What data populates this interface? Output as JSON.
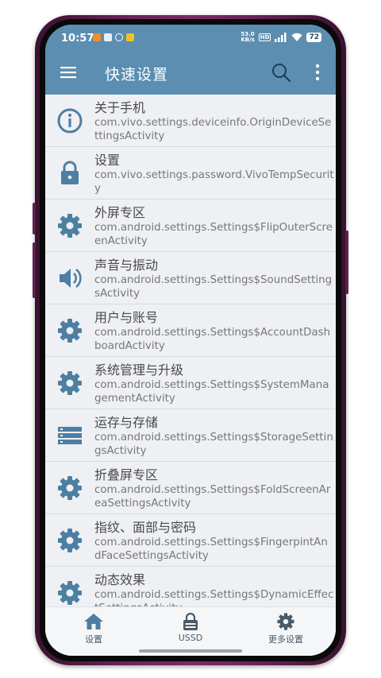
{
  "status_bar": {
    "time": "10:57",
    "net_speed_value": "53.0",
    "net_speed_unit": "KB/s",
    "hd_label": "HD",
    "battery": "72"
  },
  "toolbar": {
    "title": "快速设置",
    "menu_icon": "hamburger-menu-icon",
    "search_icon": "search-icon",
    "more_icon": "more-vert-icon"
  },
  "colors": {
    "appbar": "#5b8eb0",
    "icon": "#4d7fa2",
    "frame": "#6b2358"
  },
  "items": [
    {
      "icon": "info-icon",
      "title": "关于手机",
      "subtitle": "com.vivo.settings.deviceinfo.OriginDeviceSettingsActivity"
    },
    {
      "icon": "lock-icon",
      "title": "设置",
      "subtitle": "com.vivo.settings.password.VivoTempSecurity"
    },
    {
      "icon": "gear-icon",
      "title": "外屏专区",
      "subtitle": "com.android.settings.Settings$FlipOuterScreenActivity"
    },
    {
      "icon": "volume-icon",
      "title": "声音与振动",
      "subtitle": "com.android.settings.Settings$SoundSettingsActivity"
    },
    {
      "icon": "gear-icon",
      "title": "用户与账号",
      "subtitle": "com.android.settings.Settings$AccountDashboardActivity"
    },
    {
      "icon": "gear-icon",
      "title": "系统管理与升级",
      "subtitle": "com.android.settings.Settings$SystemManagementActivity"
    },
    {
      "icon": "storage-icon",
      "title": "运存与存储",
      "subtitle": "com.android.settings.Settings$StorageSettingsActivity"
    },
    {
      "icon": "gear-icon",
      "title": "折叠屏专区",
      "subtitle": "com.android.settings.Settings$FoldScreenAreaSettingsActivity"
    },
    {
      "icon": "gear-icon",
      "title": "指纹、面部与密码",
      "subtitle": "com.android.settings.Settings$FingerpintAndFaceSettingsActivity"
    },
    {
      "icon": "gear-icon",
      "title": "动态效果",
      "subtitle": "com.android.settings.Settings$DynamicEffectSettingsActivity"
    }
  ],
  "bottom_nav": [
    {
      "icon": "home-icon",
      "label": "设置"
    },
    {
      "icon": "ussd-lock-icon",
      "label": "USSD"
    },
    {
      "icon": "gear-icon",
      "label": "更多设置"
    }
  ]
}
